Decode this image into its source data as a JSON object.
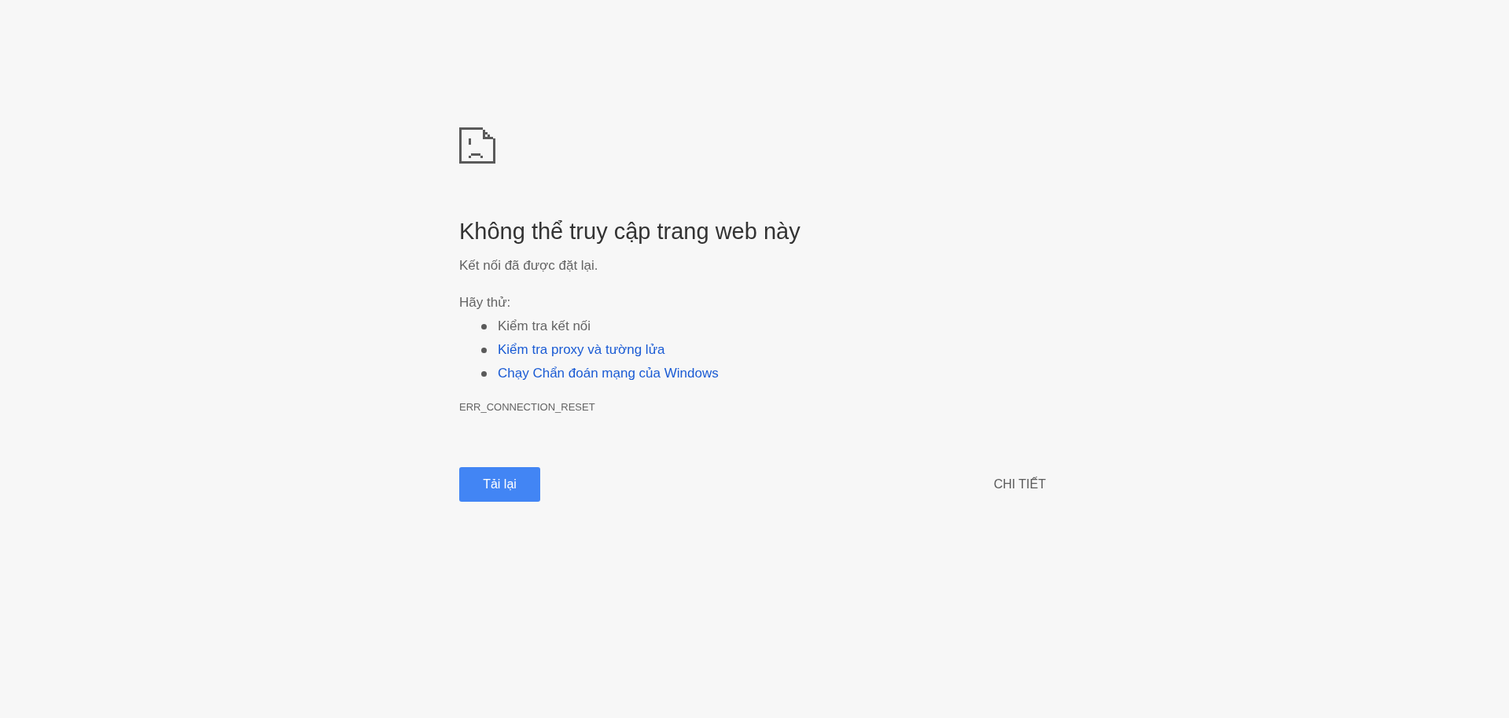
{
  "heading": "Không thể truy cập trang web này",
  "message": "Kết nối đã được đặt lại.",
  "suggestions_title": "Hãy thử:",
  "suggestions": [
    {
      "text": "Kiểm tra kết nối",
      "kind": "text"
    },
    {
      "text": "Kiểm tra proxy và tường lửa",
      "kind": "link"
    },
    {
      "text": "Chạy Chẩn đoán mạng của Windows",
      "kind": "link"
    }
  ],
  "error_code": "ERR_CONNECTION_RESET",
  "reload_button": "Tải lại",
  "details_button": "CHI TIẾT"
}
